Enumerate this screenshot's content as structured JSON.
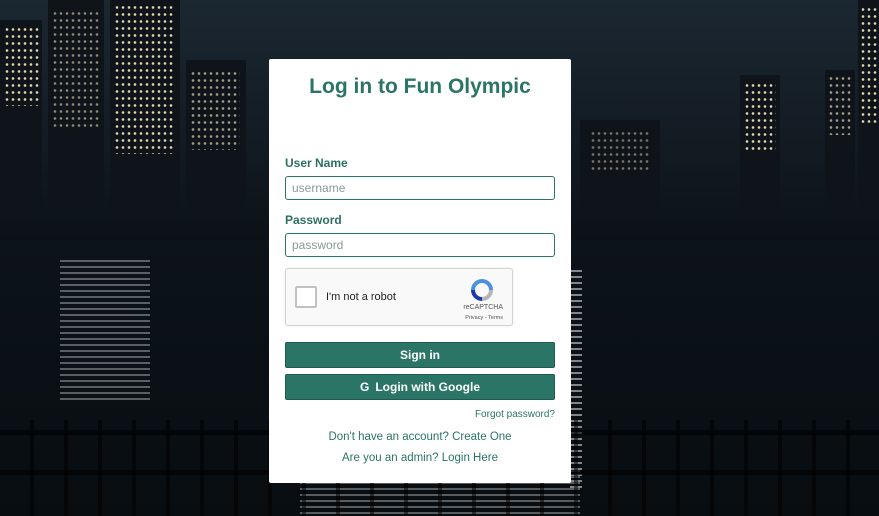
{
  "login": {
    "title": "Log in to Fun Olympic",
    "username_label": "User Name",
    "username_placeholder": "username",
    "password_label": "Password",
    "password_placeholder": "password",
    "captcha": {
      "label": "I'm not a robot",
      "brand": "reCAPTCHA",
      "links": "Privacy - Terms"
    },
    "signin_label": "Sign in",
    "google_icon": "G",
    "google_label": "Login with Google",
    "forgot_label": "Forgot password?",
    "create_account_label": "Don't have an account? Create One",
    "admin_label": "Are you an admin? Login Here"
  },
  "colors": {
    "accent": "#2a7566",
    "background": "#0b1016"
  },
  "icons": {
    "google": "google-icon",
    "recaptcha": "recaptcha-icon"
  }
}
